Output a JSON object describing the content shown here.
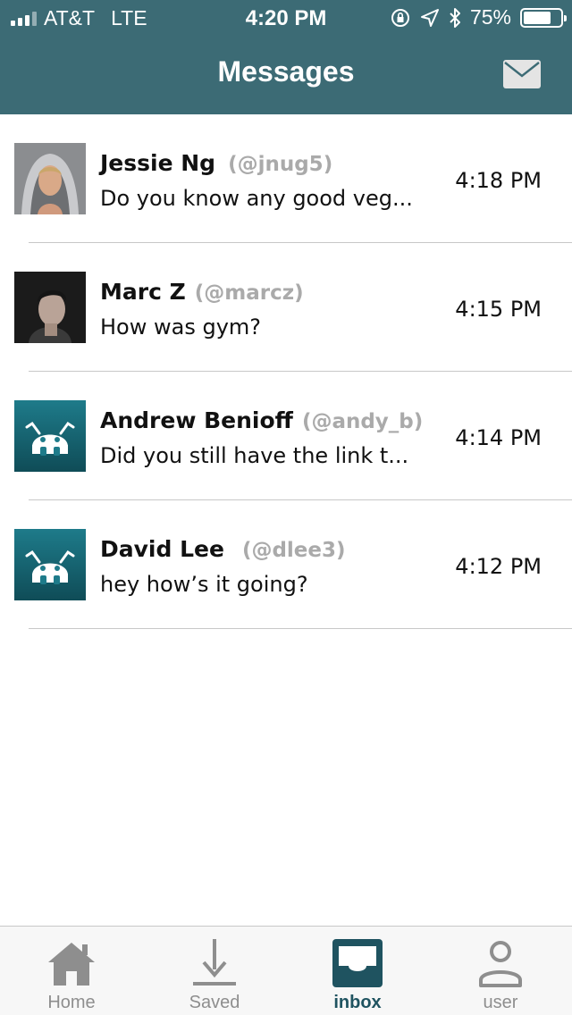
{
  "status_bar": {
    "carrier": "AT&T",
    "network": "LTE",
    "time": "4:20 PM",
    "battery_percent": "75%",
    "battery_level": 0.75
  },
  "nav": {
    "title": "Messages",
    "compose_icon": "envelope-icon"
  },
  "messages": [
    {
      "name": "Jessie Ng",
      "handle": "(@jnug5)",
      "preview": "Do you know any good veg...",
      "time": "4:18 PM",
      "avatar": "photo-hooded-man"
    },
    {
      "name": "Marc Z",
      "handle": "(@marcz)",
      "preview": "How was gym?",
      "time": "4:15 PM",
      "avatar": "photo-dark-haired-man"
    },
    {
      "name": "Andrew Benioff",
      "handle": "(@andy_b)",
      "preview": "Did you still have the link t...",
      "time": "4:14 PM",
      "avatar": "robot-logo"
    },
    {
      "name": "David Lee",
      "handle": "(@dlee3)",
      "preview": "hey how’s it going?",
      "time": "4:12 PM",
      "avatar": "robot-logo"
    }
  ],
  "tabs": [
    {
      "label": "Home",
      "icon": "home-icon",
      "active": false
    },
    {
      "label": "Saved",
      "icon": "download-icon",
      "active": false
    },
    {
      "label": "inbox",
      "icon": "inbox-icon",
      "active": true
    },
    {
      "label": "user",
      "icon": "user-icon",
      "active": false
    }
  ],
  "colors": {
    "header_bg": "#3c6b75",
    "active_tab": "#1f5360",
    "inactive_tab": "#8e8e8e",
    "handle_text": "#aaaaaa",
    "robot_avatar_bg": "#1d6f7d"
  }
}
